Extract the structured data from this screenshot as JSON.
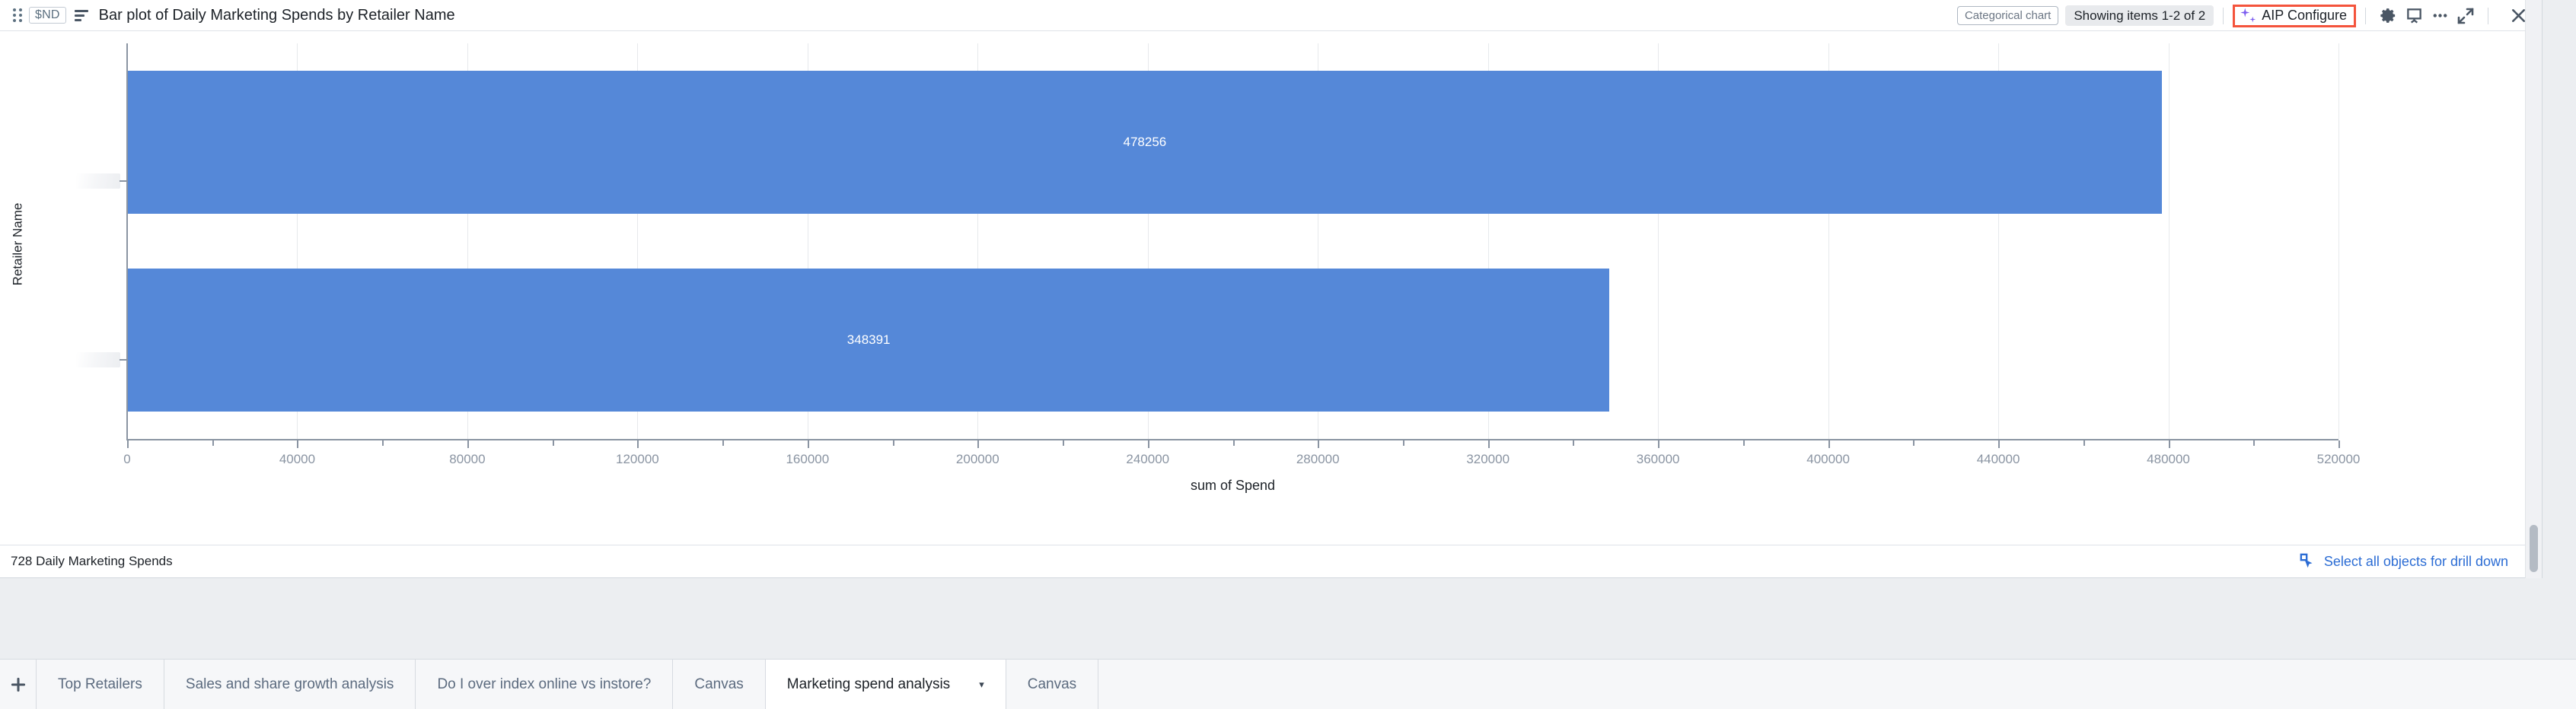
{
  "header": {
    "drag_handle_icon": "drag-dots-icon",
    "nd_badge": "$ND",
    "chart_type_icon": "bar-chart-icon",
    "title": "Bar plot of Daily Marketing Spends by Retailer Name",
    "categorical_badge": "Categorical chart",
    "showing_items": "Showing items 1-2 of 2",
    "aip_configure": "AIP Configure",
    "aip_icon": "sparkles-icon",
    "gear_icon": "gear-icon",
    "present_icon": "presentation-icon",
    "more_icon": "ellipsis-icon",
    "expand_icon": "expand-arrows-icon",
    "close_icon": "close-icon",
    "highlight_color": "#f4543c",
    "aip_icon_color": "#7b5cf0"
  },
  "chart_data": {
    "type": "bar",
    "orientation": "horizontal",
    "title": "Bar plot of Daily Marketing Spends by Retailer Name",
    "xlabel": "sum of Spend",
    "ylabel": "Retailer Name",
    "categories": [
      "[redacted]",
      "[redacted]"
    ],
    "category_labels_redacted": true,
    "values": [
      478256,
      348391
    ],
    "value_labels": [
      "478256",
      "348391"
    ],
    "xlim": [
      0,
      520000
    ],
    "xticks": [
      0,
      40000,
      80000,
      120000,
      160000,
      200000,
      240000,
      280000,
      320000,
      360000,
      400000,
      440000,
      480000,
      520000
    ],
    "xtick_labels": [
      "0",
      "40000",
      "80000",
      "120000",
      "160000",
      "200000",
      "240000",
      "280000",
      "320000",
      "360000",
      "400000",
      "440000",
      "480000",
      "520000"
    ],
    "xtick_minor_step": 20000,
    "grid": true,
    "grid_axis": "x",
    "legend": false,
    "bar_color": "#5588d8",
    "value_label_color": "#ffffff"
  },
  "footer": {
    "count_label": "728 Daily Marketing Spends",
    "drill_down_label": "Select all objects for drill down",
    "drill_down_icon": "select-cursor-icon",
    "drill_down_color": "#2b6cd4",
    "resize_handle_icon": "resize-corner-icon"
  },
  "tabbar": {
    "add_icon": "plus-icon",
    "tabs": [
      {
        "label": "Top Retailers",
        "active": false
      },
      {
        "label": "Sales and share growth analysis",
        "active": false
      },
      {
        "label": "Do I over index online vs instore?",
        "active": false
      },
      {
        "label": "Canvas",
        "active": false
      },
      {
        "label": "Marketing spend analysis",
        "active": true,
        "caret": "▾"
      },
      {
        "label": "Canvas",
        "active": false
      }
    ]
  }
}
